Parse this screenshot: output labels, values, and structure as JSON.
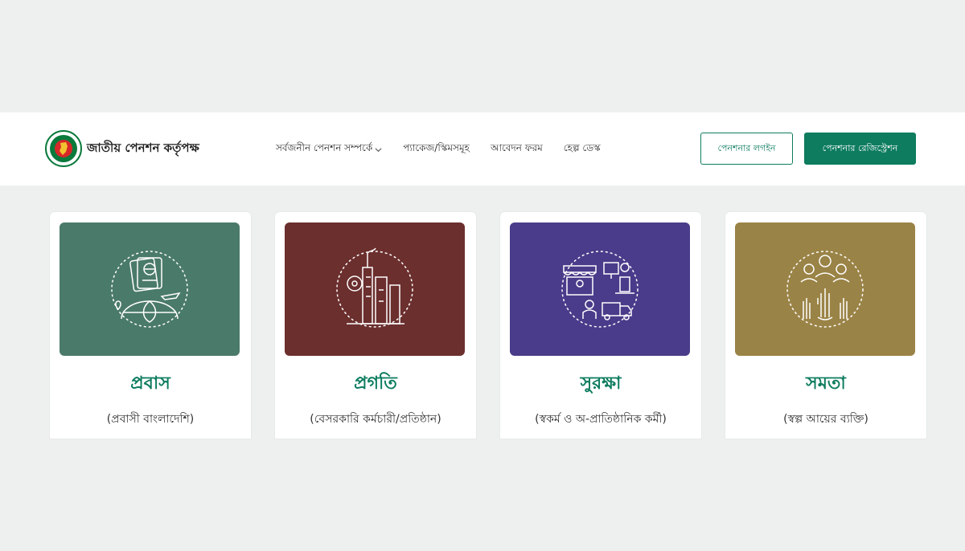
{
  "brand": {
    "name": "জাতীয় পেনশন কর্তৃপক্ষ"
  },
  "nav": {
    "about": "সর্বজনীন পেনশন সম্পর্কে",
    "packages": "প্যাকেজ/স্কিমসমূহ",
    "forms": "আবেদন ফরম",
    "help": "হেল্প ডেস্ক"
  },
  "buttons": {
    "login": "পেনশনার লগইন",
    "register": "পেনশনার রেজিস্ট্রেশন"
  },
  "colors": {
    "brand_green": "#0d7c5f",
    "probash": "#4a7a6a",
    "progoti": "#6b2f2e",
    "surokkha": "#4a3c8a",
    "somota": "#9a8346"
  },
  "schemes": [
    {
      "title": "প্রবাস",
      "subtitle": "(প্রবাসী বাংলাদেশি)",
      "icon": "passport-globe-icon"
    },
    {
      "title": "প্রগতি",
      "subtitle": "(বেসরকারি কর্মচারী/প্রতিষ্ঠান)",
      "icon": "factory-icon"
    },
    {
      "title": "সুরক্ষা",
      "subtitle": "(স্বকর্ম ও অ-প্রাতিষ্ঠানিক কর্মী)",
      "icon": "shop-worker-icon"
    },
    {
      "title": "সমতা",
      "subtitle": "(স্বল্প আয়ের ব্যক্তি)",
      "icon": "people-hands-icon"
    }
  ]
}
